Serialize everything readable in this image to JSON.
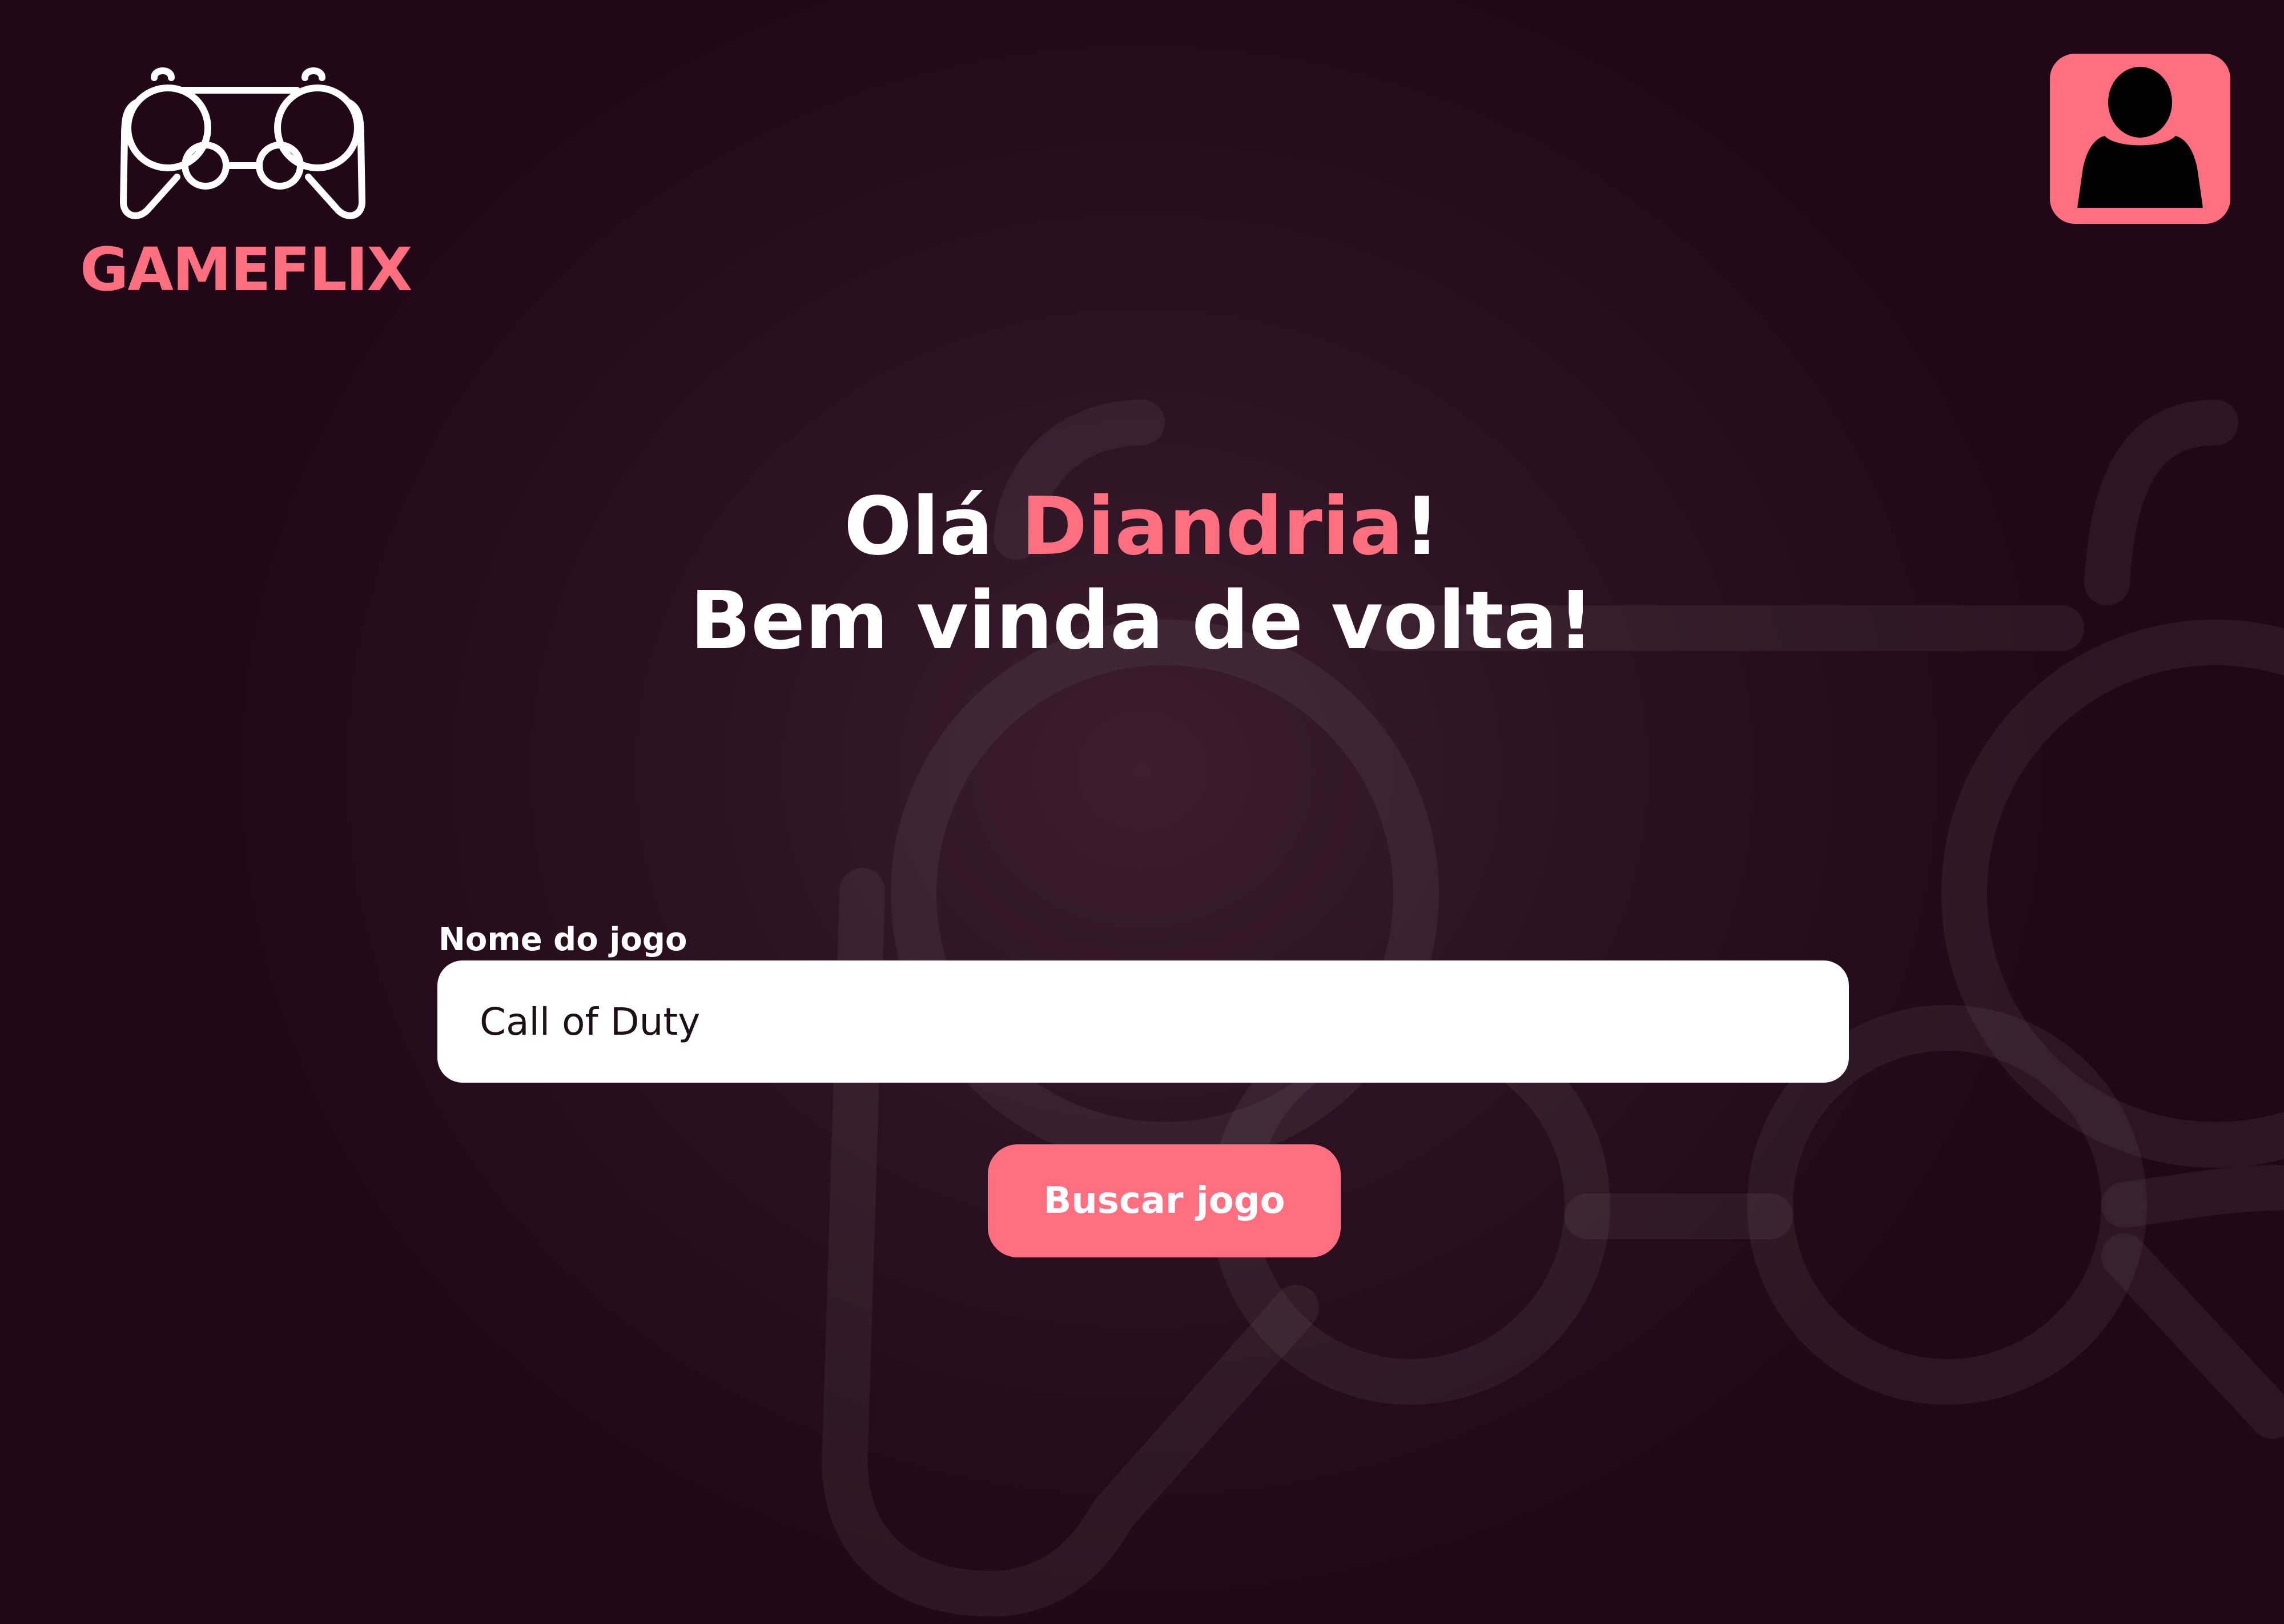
{
  "brand": {
    "name": "GAMEFLIX",
    "icon": "gamepad-icon",
    "color": "#fe6f81"
  },
  "header": {
    "profile_icon": "user-icon"
  },
  "welcome": {
    "greeting_prefix": "Olá ",
    "user_name": "Diandria",
    "greeting_suffix": "!",
    "subtitle": "Bem vinda de volta!"
  },
  "search": {
    "label": "Nome do jogo",
    "value": "Call of Duty",
    "button_label": "Buscar jogo"
  },
  "colors": {
    "accent": "#fe6f81",
    "background": "#2a1020",
    "text": "#ffffff"
  }
}
